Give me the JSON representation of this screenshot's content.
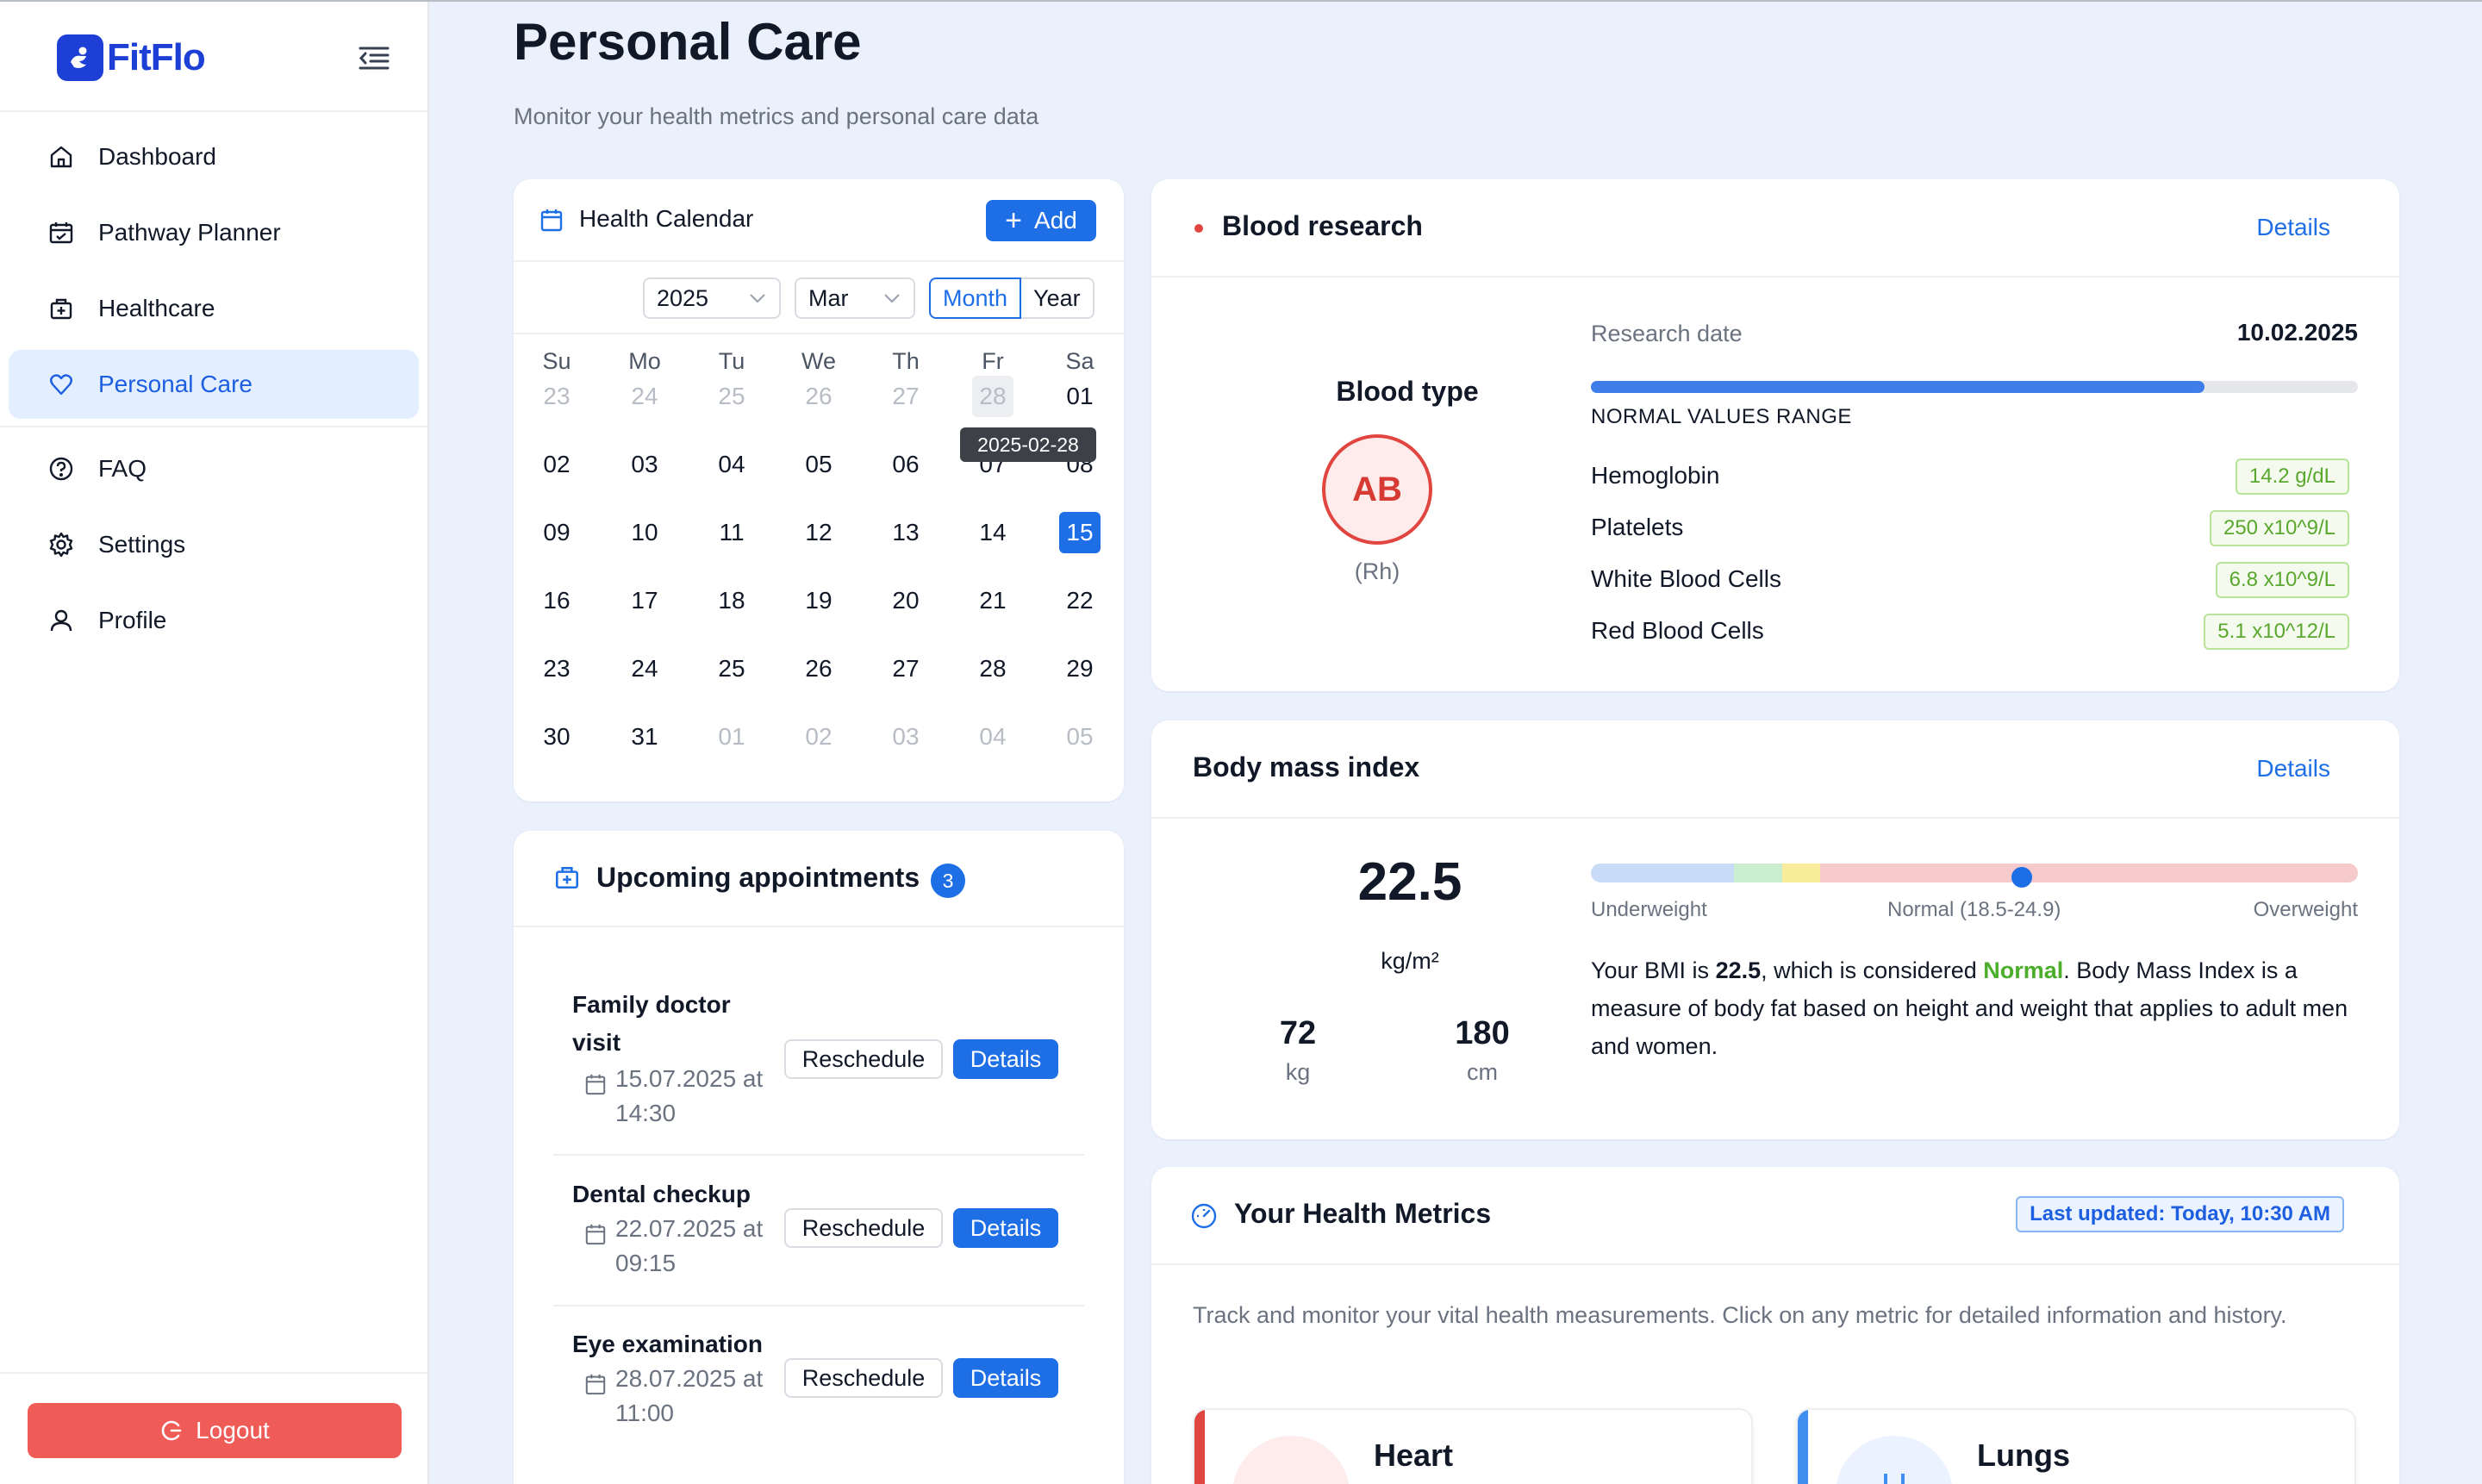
{
  "app": {
    "logo_text": "FitFlo"
  },
  "sidebar": {
    "items": [
      {
        "label": "Dashboard",
        "icon": "home-icon"
      },
      {
        "label": "Pathway Planner",
        "icon": "calendar-check-icon"
      },
      {
        "label": "Healthcare",
        "icon": "medical-bag-icon"
      },
      {
        "label": "Personal Care",
        "icon": "heart-icon",
        "active": true
      },
      {
        "label": "FAQ",
        "icon": "question-circle-icon"
      },
      {
        "label": "Settings",
        "icon": "gear-icon"
      },
      {
        "label": "Profile",
        "icon": "user-icon"
      }
    ],
    "logout_label": "Logout"
  },
  "page": {
    "title": "Personal Care",
    "subtitle": "Monitor your health metrics and personal care data"
  },
  "calendar": {
    "title": "Health Calendar",
    "add_label": "Add",
    "year_value": "2025",
    "month_value": "Mar",
    "mode_month": "Month",
    "mode_year": "Year",
    "weekdays": [
      "Su",
      "Mo",
      "Tu",
      "We",
      "Th",
      "Fr",
      "Sa"
    ],
    "weeks": [
      [
        "23",
        "24",
        "25",
        "26",
        "27",
        "28",
        "01"
      ],
      [
        "02",
        "03",
        "04",
        "05",
        "06",
        "07",
        "08"
      ],
      [
        "09",
        "10",
        "11",
        "12",
        "13",
        "14",
        "15"
      ],
      [
        "16",
        "17",
        "18",
        "19",
        "20",
        "21",
        "22"
      ],
      [
        "23",
        "24",
        "25",
        "26",
        "27",
        "28",
        "29"
      ],
      [
        "30",
        "31",
        "01",
        "02",
        "03",
        "04",
        "05"
      ]
    ],
    "today": "15",
    "tooltip": "2025-02-28"
  },
  "appointments": {
    "title": "Upcoming appointments",
    "count": "3",
    "reschedule_label": "Reschedule",
    "details_label": "Details",
    "items": [
      {
        "title_line1": "Family doctor",
        "title_line2": "visit",
        "date_line1": "15.07.2025 at",
        "date_line2": "14:30"
      },
      {
        "title_line1": "Dental checkup",
        "title_line2": "",
        "date_line1": "22.07.2025 at",
        "date_line2": "09:15"
      },
      {
        "title_line1": "Eye examination",
        "title_line2": "",
        "date_line1": "28.07.2025 at",
        "date_line2": "11:00"
      }
    ]
  },
  "blood": {
    "title": "Blood research",
    "details_label": "Details",
    "blood_type_label": "Blood type",
    "blood_type": "AB",
    "rh": "(Rh)",
    "research_date_label": "Research date",
    "research_date": "10.02.2025",
    "range_label": "NORMAL VALUES RANGE",
    "range_fill_fraction": 0.8,
    "markers": [
      {
        "name": "Hemoglobin",
        "value": "14.2 g/dL"
      },
      {
        "name": "Platelets",
        "value": "250 x10^9/L"
      },
      {
        "name": "White Blood Cells",
        "value": "6.8 x10^9/L"
      },
      {
        "name": "Red Blood Cells",
        "value": "5.1 x10^12/L"
      }
    ]
  },
  "bmi": {
    "title": "Body mass index",
    "details_label": "Details",
    "value": "22.5",
    "unit": "kg/m²",
    "weight": "72",
    "weight_unit": "kg",
    "height": "180",
    "height_unit": "cm",
    "scale_underweight": "Underweight",
    "scale_normal": "Normal (18.5-24.9)",
    "scale_overweight": "Overweight",
    "text_prefix": "Your BMI is ",
    "text_value": "22.5",
    "text_mid": ", which is considered ",
    "text_status": "Normal",
    "text_suffix": ". Body Mass Index is a measure of body fat based on height and weight that applies to adult men and women.",
    "colors": {
      "underweight": "#c9dcf7",
      "normal": "#cbeed0",
      "caution": "#f9ec9b",
      "overweight": "#f6caca"
    }
  },
  "metrics": {
    "title": "Your Health Metrics",
    "updated": "Last updated: Today, 10:30 AM",
    "description": "Track and monitor your vital health measurements. Click on any metric for detailed information and history.",
    "cards": [
      {
        "name": "Heart",
        "icon": "heart-icon",
        "color": "#e0463f"
      },
      {
        "name": "Lungs",
        "icon": "lungs-icon",
        "color": "#3f8ef0"
      }
    ]
  }
}
